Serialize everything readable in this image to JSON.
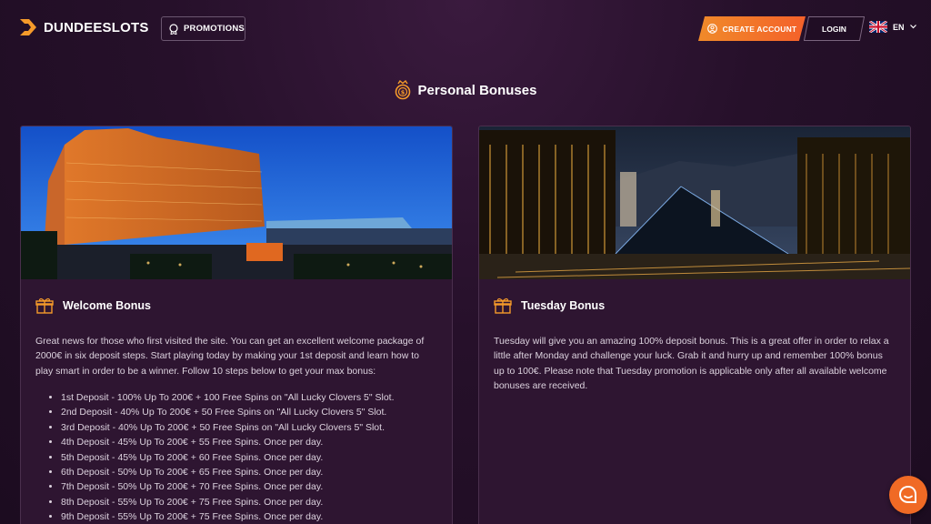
{
  "header": {
    "logo_text": "DUNDEESLOTS",
    "promotions_label": "PROMOTIONS",
    "create_account_label": "CREATE ACCOUNT",
    "login_label": "LOGIN",
    "language": "EN"
  },
  "page": {
    "title": "Personal Bonuses"
  },
  "cards": [
    {
      "title": "Welcome Bonus",
      "description": "Great news for those who first visited the site. You can get an excellent welcome package of 2000€ in six deposit steps. Start playing today by making your 1st deposit and learn how to play smart in order to be a winner. Follow 10 steps below to get your max bonus:",
      "steps": [
        "1st Deposit - 100% Up To 200€ + 100 Free Spins on \"All Lucky Clovers 5\" Slot.",
        "2nd Deposit - 40% Up To 200€ + 50 Free Spins on \"All Lucky Clovers 5\" Slot.",
        "3rd Deposit - 40% Up To 200€ + 50 Free Spins on \"All Lucky Clovers 5\" Slot.",
        "4th Deposit - 45% Up To 200€ + 55 Free Spins. Once per day.",
        "5th Deposit - 45% Up To 200€ + 60 Free Spins. Once per day.",
        "6th Deposit - 50% Up To 200€ + 65 Free Spins. Once per day.",
        "7th Deposit - 50% Up To 200€ + 70 Free Spins. Once per day.",
        "8th Deposit - 55% Up To 200€ + 75 Free Spins. Once per day.",
        "9th Deposit - 55% Up To 200€ + 75 Free Spins. Once per day."
      ]
    },
    {
      "title": "Tuesday Bonus",
      "description": "Tuesday will give you an amazing 100% deposit bonus. This is a great offer in order to relax a little after Monday and challenge your luck. Grab it and hurry up and remember 100% bonus up to 100€. Please note that Tuesday promotion is applicable only after all available welcome bonuses are received."
    }
  ],
  "colors": {
    "accent": "#f27a28",
    "background": "#26102a",
    "card": "#2e1531"
  },
  "icons": {
    "logo": "dundee-logo-icon",
    "promotions": "promo-badge-icon",
    "create_account": "user-circle-icon",
    "language_flag": "uk-flag-icon",
    "title": "coin-stack-icon",
    "card": "gift-icon",
    "chat": "chat-bubble-icon"
  }
}
